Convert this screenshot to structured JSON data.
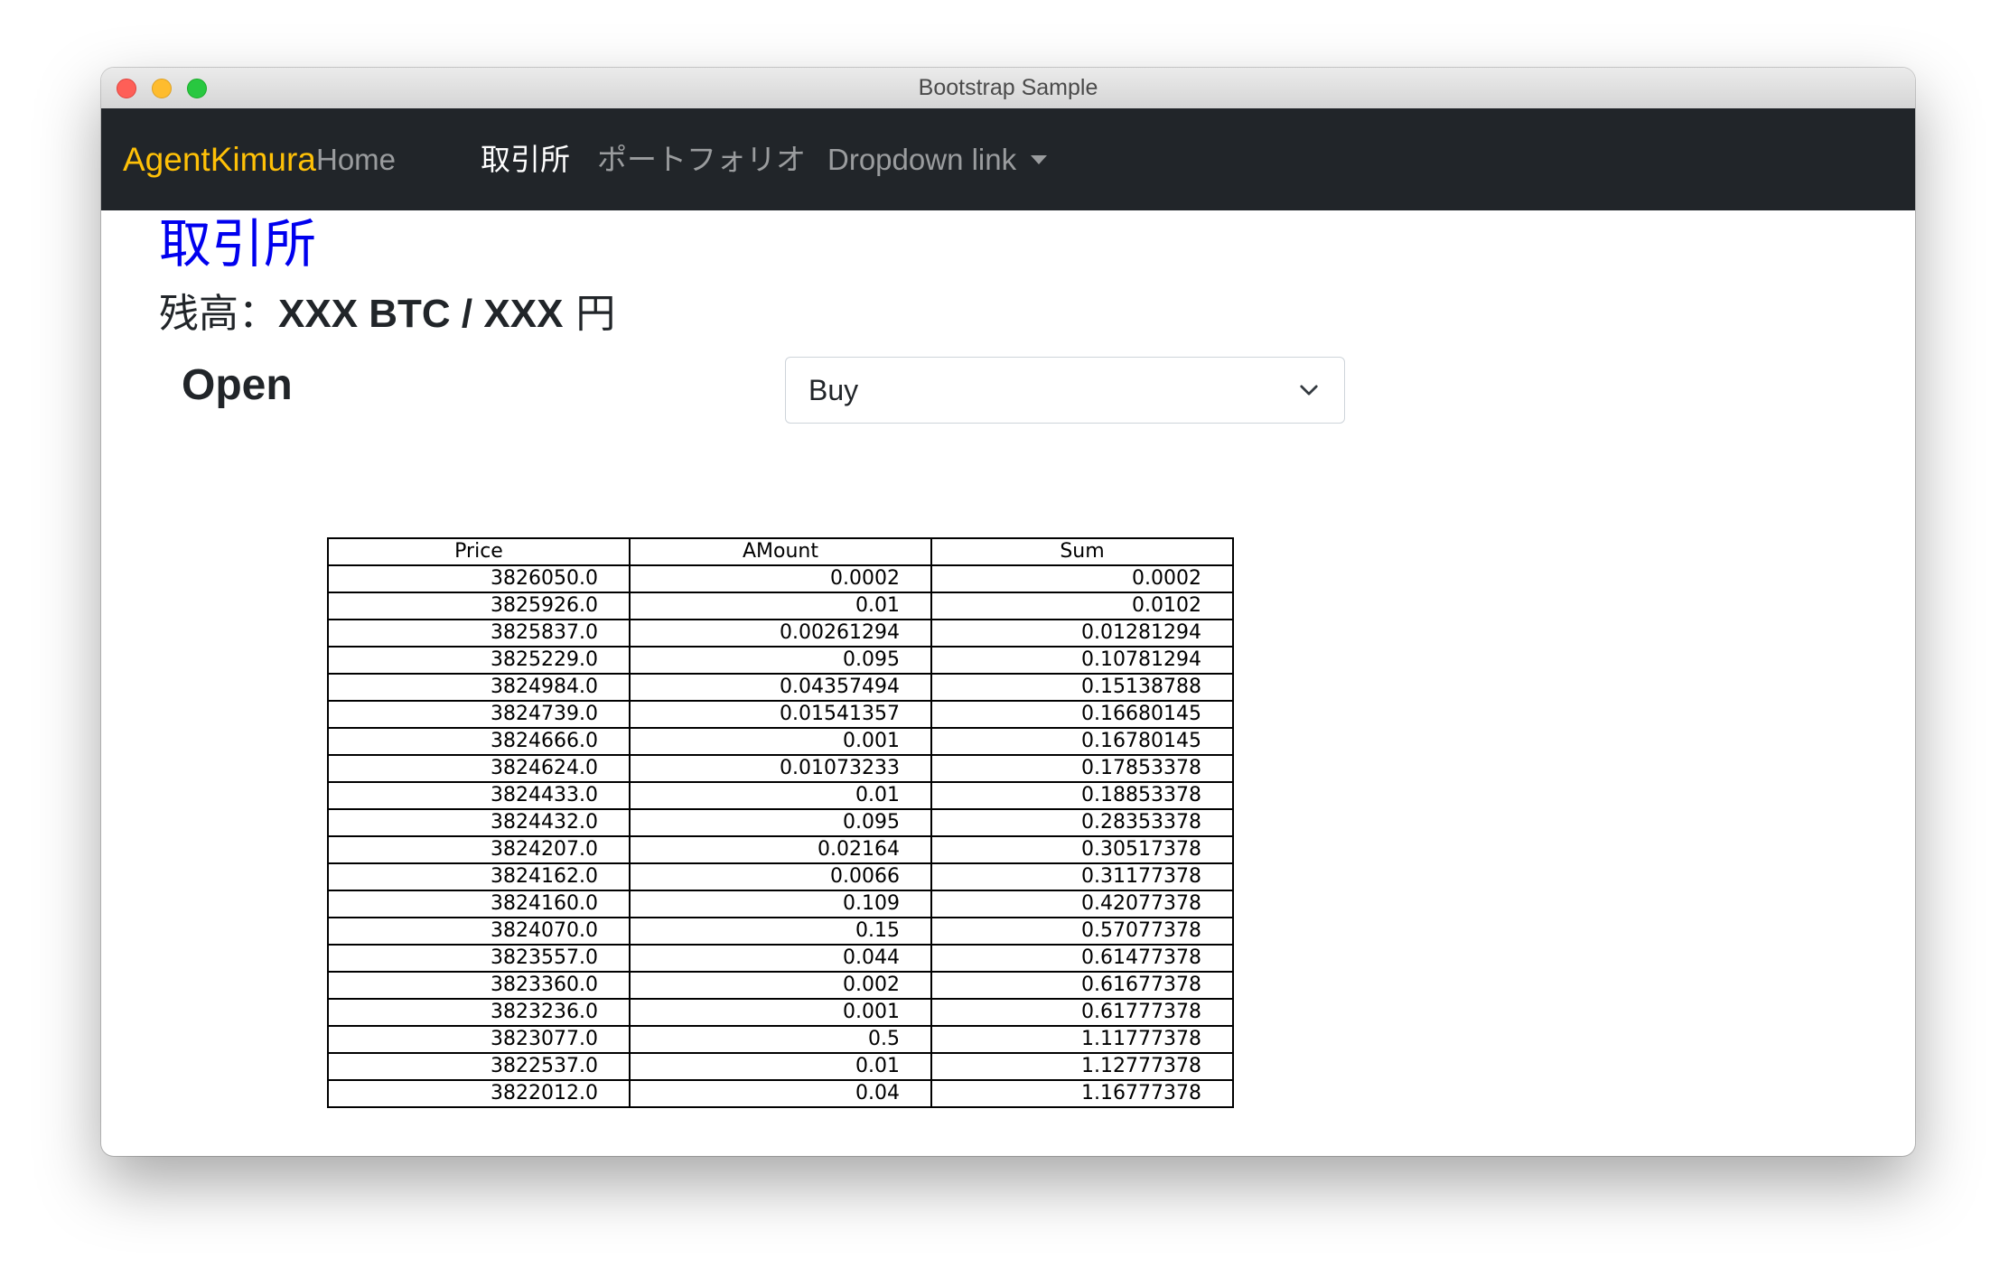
{
  "window": {
    "title": "Bootstrap Sample",
    "traffic_lights": [
      "close",
      "minimize",
      "zoom"
    ]
  },
  "navbar": {
    "brand": "AgentKimura",
    "brand_color": "#ffc107",
    "background": "#212529",
    "items": [
      {
        "label": "Home",
        "active": false
      },
      {
        "label": "取引所",
        "active": true
      },
      {
        "label": "ポートフォリオ",
        "active": false
      },
      {
        "label": "Dropdown link",
        "active": false,
        "dropdown": true
      }
    ]
  },
  "page": {
    "heading": "取引所",
    "heading_color": "#0000ee",
    "balance_prefix": "残高：",
    "balance_value": "XXX BTC / XXX",
    "balance_suffix": "円",
    "open_label": "Open",
    "order_side": {
      "selected": "Buy",
      "icon": "chevron-down-icon"
    }
  },
  "orderbook": {
    "headers": [
      "Price",
      "AMount",
      "Sum"
    ],
    "rows": [
      [
        "3826050.0",
        "0.0002",
        "0.0002"
      ],
      [
        "3825926.0",
        "0.01",
        "0.0102"
      ],
      [
        "3825837.0",
        "0.00261294",
        "0.01281294"
      ],
      [
        "3825229.0",
        "0.095",
        "0.10781294"
      ],
      [
        "3824984.0",
        "0.04357494",
        "0.15138788"
      ],
      [
        "3824739.0",
        "0.01541357",
        "0.16680145"
      ],
      [
        "3824666.0",
        "0.001",
        "0.16780145"
      ],
      [
        "3824624.0",
        "0.01073233",
        "0.17853378"
      ],
      [
        "3824433.0",
        "0.01",
        "0.18853378"
      ],
      [
        "3824432.0",
        "0.095",
        "0.28353378"
      ],
      [
        "3824207.0",
        "0.02164",
        "0.30517378"
      ],
      [
        "3824162.0",
        "0.0066",
        "0.31177378"
      ],
      [
        "3824160.0",
        "0.109",
        "0.42077378"
      ],
      [
        "3824070.0",
        "0.15",
        "0.57077378"
      ],
      [
        "3823557.0",
        "0.044",
        "0.61477378"
      ],
      [
        "3823360.0",
        "0.002",
        "0.61677378"
      ],
      [
        "3823236.0",
        "0.001",
        "0.61777378"
      ],
      [
        "3823077.0",
        "0.5",
        "1.11777378"
      ],
      [
        "3822537.0",
        "0.01",
        "1.12777378"
      ],
      [
        "3822012.0",
        "0.04",
        "1.16777378"
      ]
    ]
  }
}
